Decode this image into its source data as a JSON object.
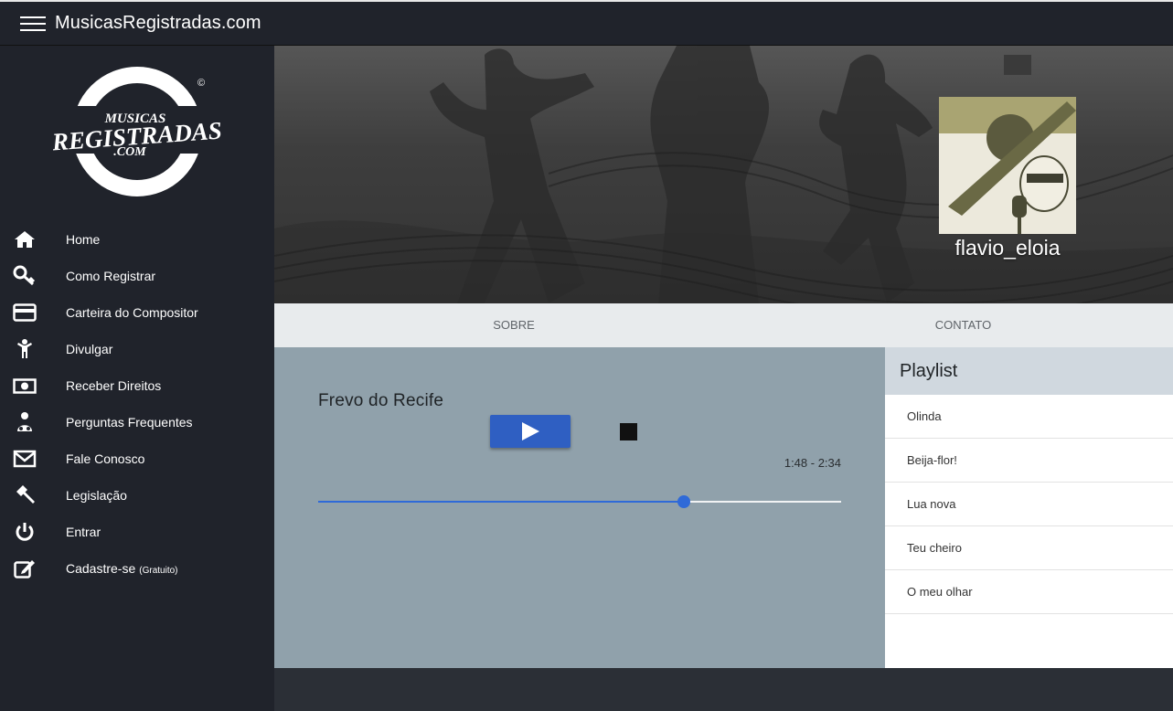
{
  "app": {
    "title": "MusicasRegistradas.com"
  },
  "logo": {
    "line1": "MUSICAS",
    "line2": "REGISTRADAS",
    "line3": ".COM",
    "mark": "©"
  },
  "sidebar": {
    "items": [
      {
        "label": "Home",
        "icon": "home-icon"
      },
      {
        "label": "Como Registrar",
        "icon": "key-icon"
      },
      {
        "label": "Carteira do Compositor",
        "icon": "credit-card-icon"
      },
      {
        "label": "Divulgar",
        "icon": "person-icon"
      },
      {
        "label": "Receber Direitos",
        "icon": "money-icon"
      },
      {
        "label": "Perguntas Frequentes",
        "icon": "question-person-icon"
      },
      {
        "label": "Fale Conosco",
        "icon": "envelope-icon"
      },
      {
        "label": "Legislação",
        "icon": "gavel-icon"
      },
      {
        "label": "Entrar",
        "icon": "power-icon"
      },
      {
        "label": "Cadastre-se",
        "suffix": "(Gratuito)",
        "icon": "edit-icon"
      }
    ]
  },
  "profile": {
    "username": "flavio_eloia"
  },
  "tabs": [
    {
      "label": "SOBRE"
    },
    {
      "label": "CONTATO"
    }
  ],
  "player": {
    "song_title": "Frevo do Recife",
    "time": "1:48 - 2:34",
    "progress": 0.699,
    "accent": "#2f6ad8"
  },
  "playlist": {
    "title": "Playlist",
    "items": [
      "Olinda",
      "Beija-flor!",
      "Lua nova",
      "Teu cheiro",
      "O meu olhar"
    ]
  }
}
